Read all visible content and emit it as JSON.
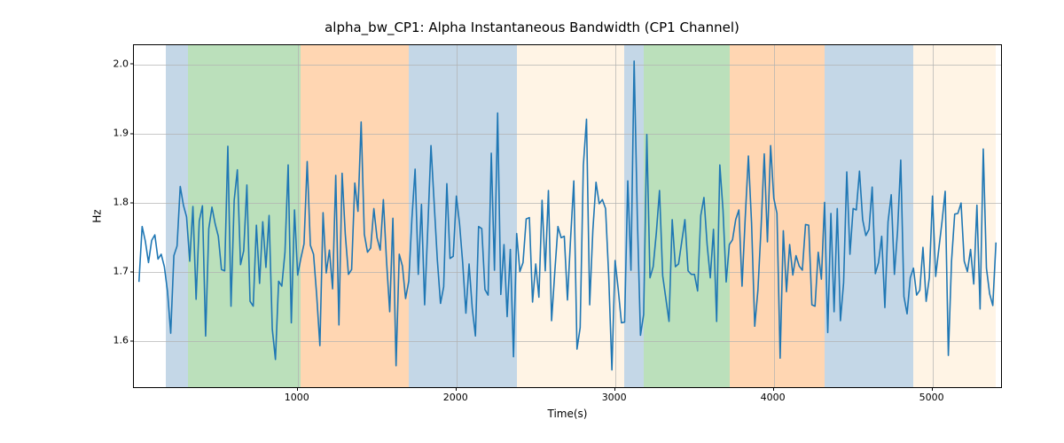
{
  "chart_data": {
    "type": "line",
    "title": "alpha_bw_CP1: Alpha Instantaneous Bandwidth (CP1 Channel)",
    "xlabel": "Time(s)",
    "ylabel": "Hz",
    "xlim": [
      -32,
      5432
    ],
    "ylim": [
      1.534,
      2.028
    ],
    "xticks": [
      1000,
      2000,
      3000,
      4000,
      5000
    ],
    "yticks": [
      1.6,
      1.7,
      1.8,
      1.9,
      2.0
    ],
    "bands": [
      {
        "x0": 170,
        "x1": 310,
        "color": "#4682b4"
      },
      {
        "x0": 310,
        "x1": 1020,
        "color": "#2ca02c"
      },
      {
        "x0": 1020,
        "x1": 1700,
        "color": "#ff7f0e"
      },
      {
        "x0": 1700,
        "x1": 2380,
        "color": "#4682b4"
      },
      {
        "x0": 2380,
        "x1": 3060,
        "color": "#ffdead"
      },
      {
        "x0": 3060,
        "x1": 3180,
        "color": "#4682b4"
      },
      {
        "x0": 3180,
        "x1": 3720,
        "color": "#2ca02c"
      },
      {
        "x0": 3720,
        "x1": 4320,
        "color": "#ff7f0e"
      },
      {
        "x0": 4320,
        "x1": 4880,
        "color": "#4682b4"
      },
      {
        "x0": 4880,
        "x1": 5400,
        "color": "#ffdead"
      }
    ],
    "x": [
      0,
      20,
      40,
      60,
      80,
      100,
      120,
      140,
      160,
      180,
      200,
      220,
      240,
      260,
      280,
      300,
      320,
      340,
      360,
      380,
      400,
      420,
      440,
      460,
      480,
      500,
      520,
      540,
      560,
      580,
      600,
      620,
      640,
      660,
      680,
      700,
      720,
      740,
      760,
      780,
      800,
      820,
      840,
      860,
      880,
      900,
      920,
      940,
      960,
      980,
      1000,
      1020,
      1040,
      1060,
      1080,
      1100,
      1120,
      1140,
      1160,
      1180,
      1200,
      1220,
      1240,
      1260,
      1280,
      1300,
      1320,
      1340,
      1360,
      1380,
      1400,
      1420,
      1440,
      1460,
      1480,
      1500,
      1520,
      1540,
      1560,
      1580,
      1600,
      1620,
      1640,
      1660,
      1680,
      1700,
      1720,
      1740,
      1760,
      1780,
      1800,
      1820,
      1840,
      1860,
      1880,
      1900,
      1920,
      1940,
      1960,
      1980,
      2000,
      2020,
      2040,
      2060,
      2080,
      2100,
      2120,
      2140,
      2160,
      2180,
      2200,
      2220,
      2240,
      2260,
      2280,
      2300,
      2320,
      2340,
      2360,
      2380,
      2400,
      2420,
      2440,
      2460,
      2480,
      2500,
      2520,
      2540,
      2560,
      2580,
      2600,
      2620,
      2640,
      2660,
      2680,
      2700,
      2720,
      2740,
      2760,
      2780,
      2800,
      2820,
      2840,
      2860,
      2880,
      2900,
      2920,
      2940,
      2960,
      2980,
      3000,
      3020,
      3040,
      3060,
      3080,
      3100,
      3120,
      3140,
      3160,
      3180,
      3200,
      3220,
      3240,
      3260,
      3280,
      3300,
      3320,
      3340,
      3360,
      3380,
      3400,
      3420,
      3440,
      3460,
      3480,
      3500,
      3520,
      3540,
      3560,
      3580,
      3600,
      3620,
      3640,
      3660,
      3680,
      3700,
      3720,
      3740,
      3760,
      3780,
      3800,
      3820,
      3840,
      3860,
      3880,
      3900,
      3920,
      3940,
      3960,
      3980,
      4000,
      4020,
      4040,
      4060,
      4080,
      4100,
      4120,
      4140,
      4160,
      4180,
      4200,
      4220,
      4240,
      4260,
      4280,
      4300,
      4320,
      4340,
      4360,
      4380,
      4400,
      4420,
      4440,
      4460,
      4480,
      4500,
      4520,
      4540,
      4560,
      4580,
      4600,
      4620,
      4640,
      4660,
      4680,
      4700,
      4720,
      4740,
      4760,
      4780,
      4800,
      4820,
      4840,
      4860,
      4880,
      4900,
      4920,
      4940,
      4960,
      4980,
      5000,
      5020,
      5040,
      5060,
      5080,
      5100,
      5120,
      5140,
      5160,
      5180,
      5200,
      5220,
      5240,
      5260,
      5280,
      5300,
      5320,
      5340,
      5360,
      5380,
      5400
    ],
    "values": [
      1.686,
      1.766,
      1.745,
      1.714,
      1.746,
      1.754,
      1.719,
      1.726,
      1.708,
      1.672,
      1.612,
      1.724,
      1.738,
      1.824,
      1.797,
      1.78,
      1.716,
      1.795,
      1.661,
      1.774,
      1.796,
      1.608,
      1.763,
      1.794,
      1.77,
      1.752,
      1.704,
      1.702,
      1.882,
      1.651,
      1.804,
      1.848,
      1.711,
      1.731,
      1.826,
      1.658,
      1.651,
      1.768,
      1.684,
      1.773,
      1.707,
      1.782,
      1.618,
      1.574,
      1.687,
      1.68,
      1.729,
      1.855,
      1.627,
      1.79,
      1.696,
      1.72,
      1.741,
      1.86,
      1.739,
      1.726,
      1.666,
      1.594,
      1.786,
      1.699,
      1.732,
      1.676,
      1.84,
      1.624,
      1.843,
      1.755,
      1.697,
      1.704,
      1.829,
      1.788,
      1.917,
      1.755,
      1.729,
      1.735,
      1.792,
      1.75,
      1.732,
      1.805,
      1.716,
      1.643,
      1.778,
      1.565,
      1.726,
      1.709,
      1.662,
      1.687,
      1.778,
      1.849,
      1.697,
      1.798,
      1.653,
      1.764,
      1.883,
      1.8,
      1.718,
      1.655,
      1.679,
      1.828,
      1.72,
      1.723,
      1.81,
      1.77,
      1.713,
      1.641,
      1.712,
      1.648,
      1.608,
      1.766,
      1.763,
      1.675,
      1.667,
      1.872,
      1.703,
      1.93,
      1.668,
      1.74,
      1.636,
      1.733,
      1.578,
      1.756,
      1.701,
      1.714,
      1.777,
      1.779,
      1.657,
      1.712,
      1.664,
      1.804,
      1.702,
      1.818,
      1.63,
      1.7,
      1.766,
      1.75,
      1.752,
      1.66,
      1.75,
      1.832,
      1.589,
      1.62,
      1.854,
      1.921,
      1.653,
      1.761,
      1.83,
      1.799,
      1.805,
      1.792,
      1.694,
      1.559,
      1.717,
      1.675,
      1.627,
      1.628,
      1.832,
      1.703,
      2.005,
      1.782,
      1.609,
      1.639,
      1.899,
      1.692,
      1.708,
      1.757,
      1.818,
      1.695,
      1.662,
      1.629,
      1.776,
      1.708,
      1.712,
      1.744,
      1.776,
      1.702,
      1.697,
      1.697,
      1.673,
      1.782,
      1.808,
      1.74,
      1.692,
      1.762,
      1.629,
      1.855,
      1.79,
      1.686,
      1.74,
      1.747,
      1.776,
      1.79,
      1.68,
      1.778,
      1.868,
      1.771,
      1.622,
      1.674,
      1.765,
      1.871,
      1.744,
      1.883,
      1.807,
      1.785,
      1.576,
      1.76,
      1.672,
      1.74,
      1.696,
      1.724,
      1.709,
      1.703,
      1.769,
      1.768,
      1.653,
      1.651,
      1.729,
      1.69,
      1.801,
      1.613,
      1.785,
      1.643,
      1.792,
      1.63,
      1.685,
      1.845,
      1.726,
      1.792,
      1.79,
      1.846,
      1.776,
      1.753,
      1.762,
      1.823,
      1.698,
      1.714,
      1.752,
      1.649,
      1.773,
      1.812,
      1.697,
      1.76,
      1.862,
      1.665,
      1.64,
      1.692,
      1.706,
      1.667,
      1.674,
      1.736,
      1.658,
      1.692,
      1.81,
      1.694,
      1.734,
      1.773,
      1.817,
      1.58,
      1.716,
      1.784,
      1.785,
      1.8,
      1.716,
      1.701,
      1.733,
      1.683,
      1.797,
      1.647,
      1.878,
      1.706,
      1.669,
      1.652,
      1.743
    ]
  }
}
